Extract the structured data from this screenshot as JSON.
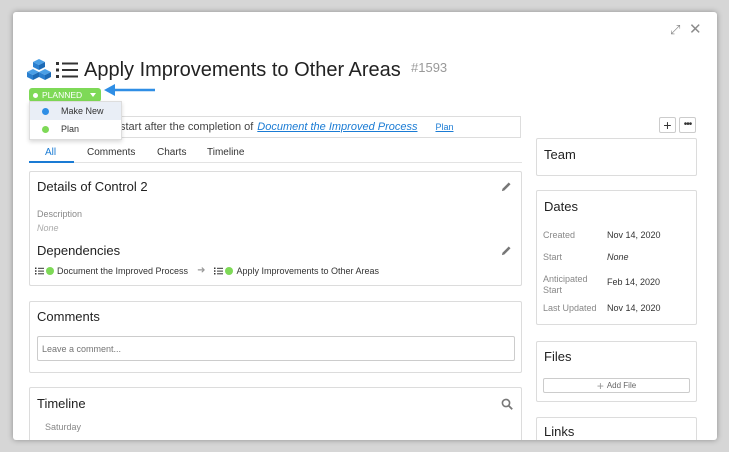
{
  "header": {
    "title": "Apply Improvements to Other Areas",
    "issue_id": "#1593"
  },
  "status": {
    "label": "PLANNED",
    "color": "#7ed957",
    "menu": [
      {
        "label": "Make New",
        "color": "#2f8ee5"
      },
      {
        "label": "Plan",
        "color": "#7ed957"
      }
    ]
  },
  "dependency_banner": {
    "text": "start after the completion of",
    "link": "Document the Improved Process",
    "action": "Plan"
  },
  "tabs": [
    "All",
    "Comments",
    "Charts",
    "Timeline"
  ],
  "details": {
    "title": "Details of Control 2",
    "description_label": "Description",
    "description_value": "None",
    "dependencies_title": "Dependencies",
    "dep_from": "Document the Improved Process",
    "dep_to": "Apply Improvements to Other Areas"
  },
  "comments": {
    "title": "Comments",
    "placeholder": "Leave a comment..."
  },
  "timeline": {
    "title": "Timeline",
    "day": "Saturday"
  },
  "sidebar": {
    "team_title": "Team",
    "dates_title": "Dates",
    "dates": [
      {
        "label": "Created",
        "value": "Nov 14, 2020"
      },
      {
        "label": "Start",
        "value": "None"
      },
      {
        "label": "Anticipated Start",
        "value": "Feb 14, 2020"
      },
      {
        "label": "Last Updated",
        "value": "Nov 14, 2020"
      }
    ],
    "files_title": "Files",
    "add_file": "Add File",
    "links_title": "Links"
  },
  "icons": {
    "add": "plus-icon",
    "more": "more-icon",
    "expand": "expand-icon",
    "close": "close-icon"
  },
  "accent_color": "#1a7bd4"
}
